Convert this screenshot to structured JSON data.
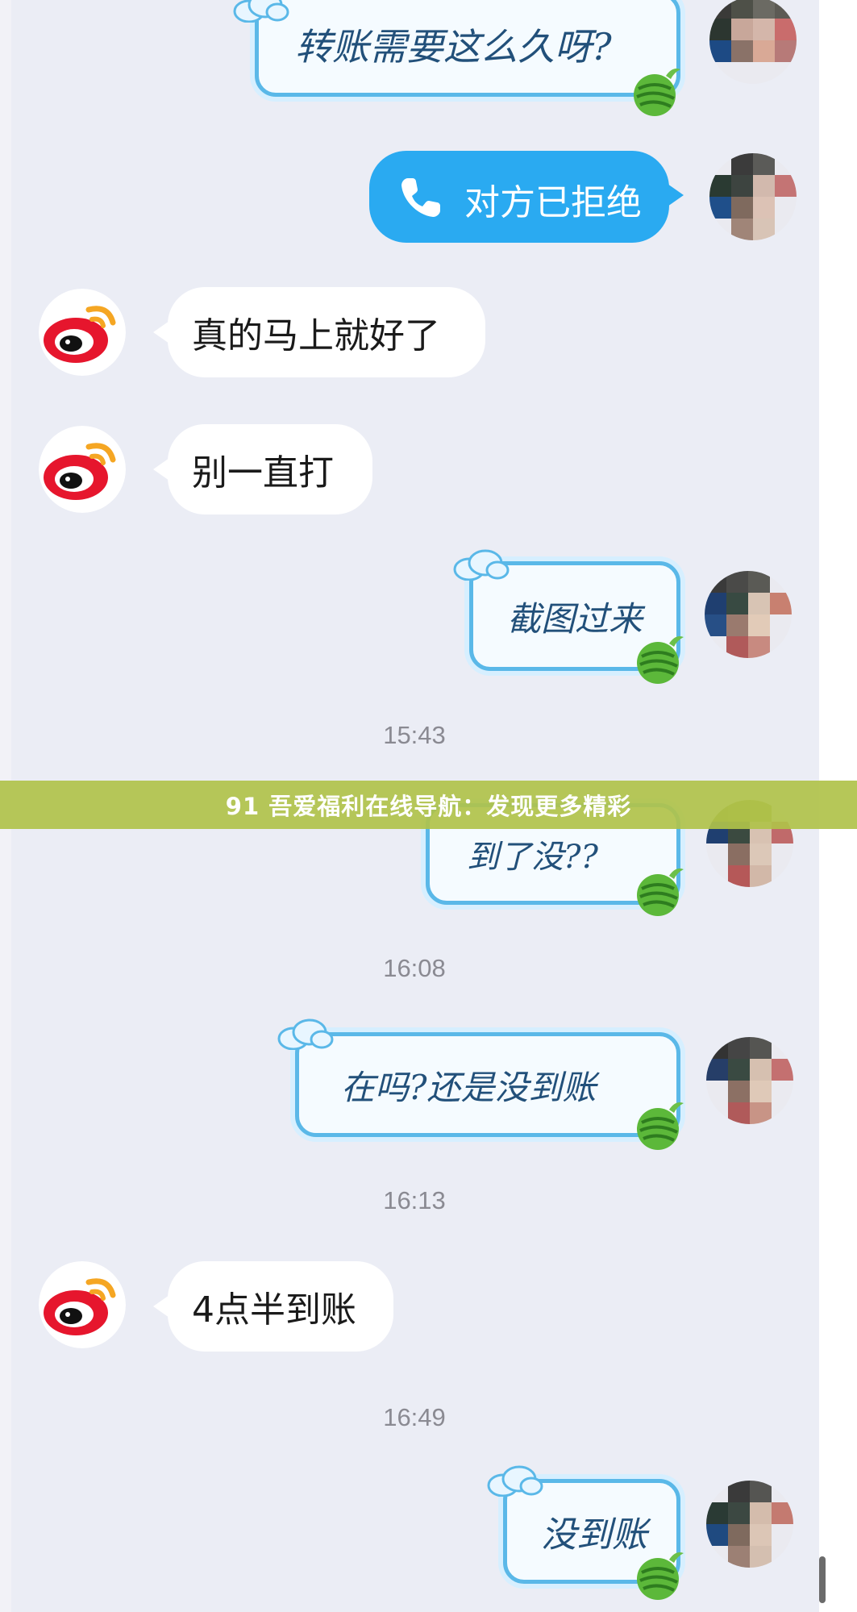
{
  "messages": {
    "m1": "转账需要这么久呀?",
    "m2": "对方已拒绝",
    "m3": "真的马上就好了",
    "m4": "别一直打",
    "m5": "截图过来",
    "m6": "到了没??",
    "m7": "在吗?还是没到账",
    "m8": "4点半到账",
    "m9": "没到账"
  },
  "timestamps": {
    "t1": "15:43",
    "t2": "16:08",
    "t3": "16:13",
    "t4": "16:49"
  },
  "banner": {
    "text": "91 吾爱福利在线导航：发现更多精彩"
  },
  "icons": {
    "phone": "phone-icon",
    "weibo": "weibo-logo",
    "cloud": "cloud-decoration",
    "watermelon": "watermelon-decoration"
  },
  "colors": {
    "background": "#ebedf5",
    "call_bubble": "#2aaaf1",
    "sticker_border": "#5ab8e8",
    "banner": "#b0c24a",
    "weibo_red": "#e6162d",
    "weibo_orange": "#f5a623"
  }
}
